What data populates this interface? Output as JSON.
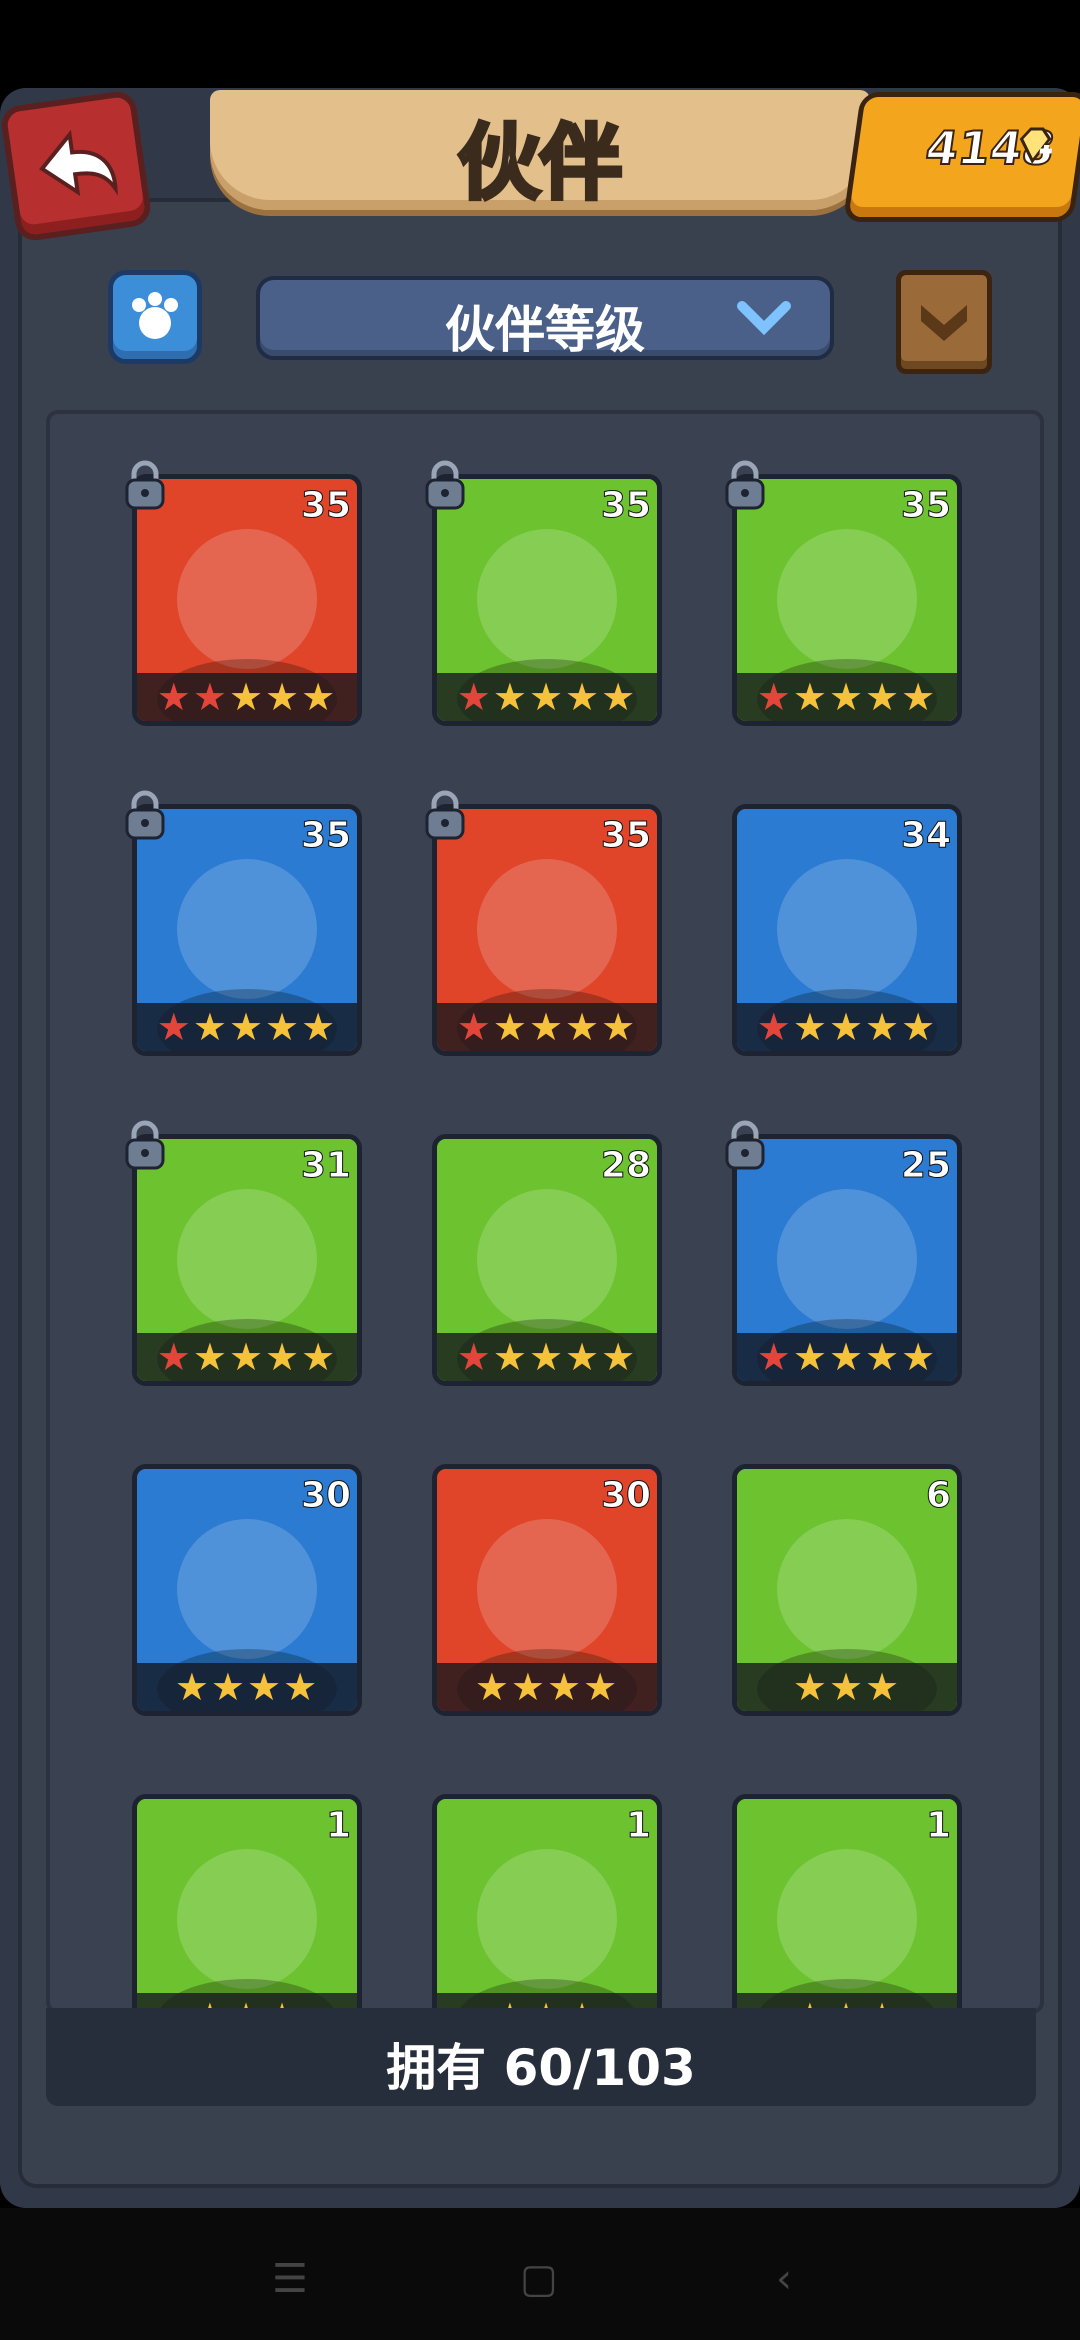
{
  "header": {
    "title": "伙伴",
    "gems": "4148"
  },
  "toolbar": {
    "dropdown_label": "伙伴等级"
  },
  "cards": [
    {
      "level": "35",
      "stars": "★★★★★",
      "red_stars": 2,
      "locked": true,
      "palette": "red"
    },
    {
      "level": "35",
      "stars": "★★★★★",
      "red_stars": 1,
      "locked": true,
      "palette": "green"
    },
    {
      "level": "35",
      "stars": "★★★★★",
      "red_stars": 1,
      "locked": true,
      "palette": "green"
    },
    {
      "level": "35",
      "stars": "★★★★★",
      "red_stars": 1,
      "locked": true,
      "palette": "blue"
    },
    {
      "level": "35",
      "stars": "★★★★★",
      "red_stars": 1,
      "locked": true,
      "palette": "red"
    },
    {
      "level": "34",
      "stars": "★★★★★",
      "red_stars": 1,
      "locked": false,
      "palette": "blue"
    },
    {
      "level": "31",
      "stars": "★★★★★",
      "red_stars": 1,
      "locked": true,
      "palette": "green"
    },
    {
      "level": "28",
      "stars": "★★★★★",
      "red_stars": 1,
      "locked": false,
      "palette": "green"
    },
    {
      "level": "25",
      "stars": "★★★★★",
      "red_stars": 1,
      "locked": true,
      "palette": "blue"
    },
    {
      "level": "30",
      "stars": "★★★★",
      "red_stars": 0,
      "locked": false,
      "palette": "blue"
    },
    {
      "level": "30",
      "stars": "★★★★",
      "red_stars": 0,
      "locked": false,
      "palette": "red"
    },
    {
      "level": "6",
      "stars": "★★★",
      "red_stars": 0,
      "locked": false,
      "palette": "green"
    },
    {
      "level": "1",
      "stars": "★★★",
      "red_stars": 0,
      "locked": false,
      "palette": "green"
    },
    {
      "level": "1",
      "stars": "★★★",
      "red_stars": 0,
      "locked": false,
      "palette": "green"
    },
    {
      "level": "1",
      "stars": "★★★",
      "red_stars": 0,
      "locked": false,
      "palette": "green"
    }
  ],
  "footer": {
    "owned": "拥有 60/103"
  },
  "colors": {
    "red": "#e0452a",
    "green": "#6cc22f",
    "blue": "#2a7bd1"
  }
}
